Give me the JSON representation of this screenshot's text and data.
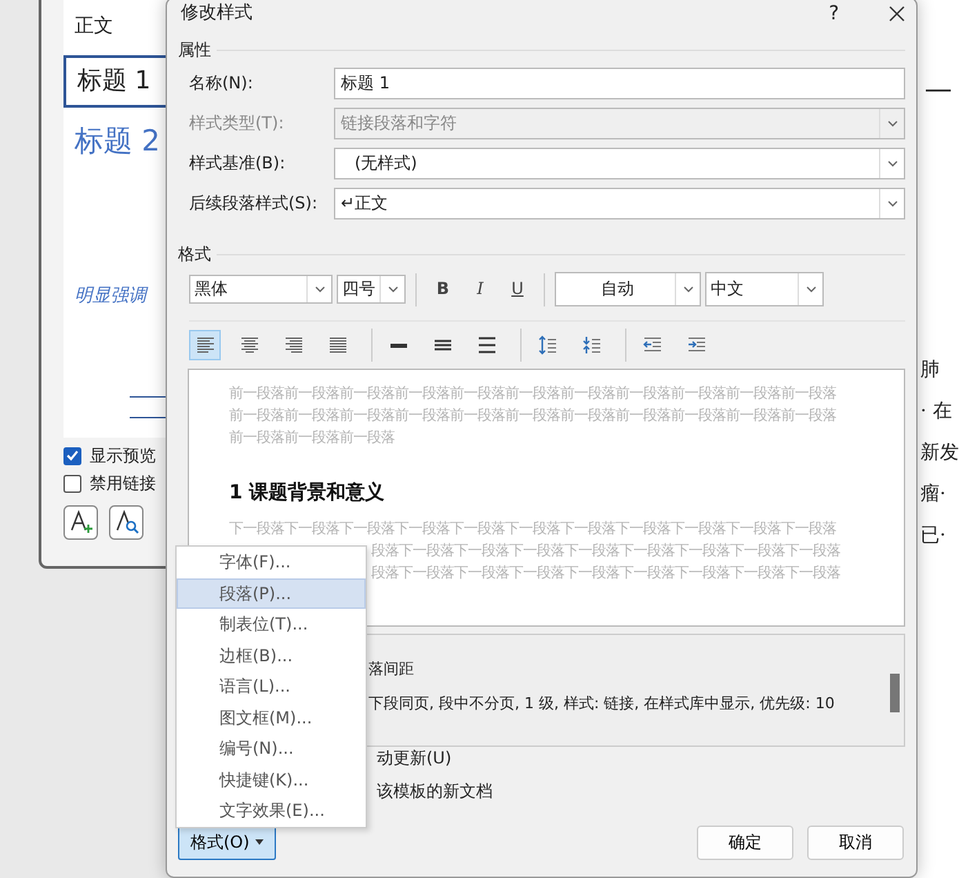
{
  "document": {
    "heading_mark": "—",
    "lines": [
      "肺",
      "· 在",
      "新发",
      "瘤·",
      "已·"
    ]
  },
  "styles_pane": {
    "styles": [
      {
        "label": "正文",
        "kind": "normal",
        "selected": false
      },
      {
        "label": "标题 1",
        "kind": "heading1",
        "selected": true
      },
      {
        "label": "标题 2",
        "kind": "heading2",
        "selected": false
      },
      {
        "label": "明显强调",
        "kind": "emphasis",
        "selected": false
      }
    ],
    "options": [
      {
        "label": "显示预览",
        "checked": true
      },
      {
        "label": "禁用链接",
        "checked": false
      }
    ]
  },
  "dialog": {
    "title": "修改样式",
    "help": "?",
    "properties_heading": "属性",
    "fields": [
      {
        "label": "名称(N):",
        "value": "标题 1",
        "kind": "text",
        "disabled": false
      },
      {
        "label": "样式类型(T):",
        "value": "链接段落和字符",
        "kind": "select",
        "disabled": true
      },
      {
        "label": "样式基准(B):",
        "value": "(无样式)",
        "kind": "select",
        "disabled": false
      },
      {
        "label": "后续段落样式(S):",
        "value": "↵正文",
        "kind": "select",
        "disabled": false
      }
    ],
    "format_heading": "格式",
    "font": "黑体",
    "size": "四号",
    "bold": "B",
    "italic": "I",
    "underline": "U",
    "font_color": "自动",
    "script": "中文",
    "paragraph_buttons": [
      {
        "kind": "align-left",
        "selected": true
      },
      {
        "kind": "align-center",
        "selected": false
      },
      {
        "kind": "align-right",
        "selected": false
      },
      {
        "kind": "justify",
        "selected": false
      },
      {
        "kind": "single",
        "selected": false
      },
      {
        "kind": "one-half",
        "selected": false
      },
      {
        "kind": "double",
        "selected": false
      },
      {
        "kind": "space-more",
        "selected": false
      },
      {
        "kind": "space-less",
        "selected": false
      },
      {
        "kind": "indent-less",
        "selected": false
      },
      {
        "kind": "indent-more",
        "selected": false
      }
    ],
    "preview": {
      "before_lines": [
        "前一段落前一段落前一段落前一段落前一段落前一段落前一段落前一段落前一段落前一段落前一段落",
        "前一段落前一段落前一段落前一段落前一段落前一段落前一段落前一段落前一段落前一段落前一段落",
        "前一段落前一段落前一段落"
      ],
      "sample": "1 课题背景和意义",
      "after_lines": [
        "下一段落下一段落下一段落下一段落下一段落下一段落下一段落下一段落下一段落下一段落下一段落",
        "段落下一段落下一段落下一段落下一段落下一段落下一段落下一段落下一段落",
        "段落下一段落下一段落下一段落下一段落下一段落下一段落下一段落下一段落"
      ]
    },
    "description_lines": [
      "落间距",
      "下段同页, 段中不分页, 1 级, 样式: 链接, 在样式库中显示, 优先级: 10"
    ],
    "options": [
      "动更新(U)",
      "该模板的新文档"
    ],
    "format_button": "格式(O)",
    "ok": "确定",
    "cancel": "取消"
  },
  "menu": [
    {
      "label": "字体(F)...",
      "selected": false
    },
    {
      "label": "段落(P)...",
      "selected": true
    },
    {
      "label": "制表位(T)...",
      "selected": false
    },
    {
      "label": "边框(B)...",
      "selected": false
    },
    {
      "label": "语言(L)...",
      "selected": false
    },
    {
      "label": "图文框(M)...",
      "selected": false
    },
    {
      "label": "编号(N)...",
      "selected": false
    },
    {
      "label": "快捷键(K)...",
      "selected": false
    },
    {
      "label": "文字效果(E)...",
      "selected": false
    }
  ]
}
